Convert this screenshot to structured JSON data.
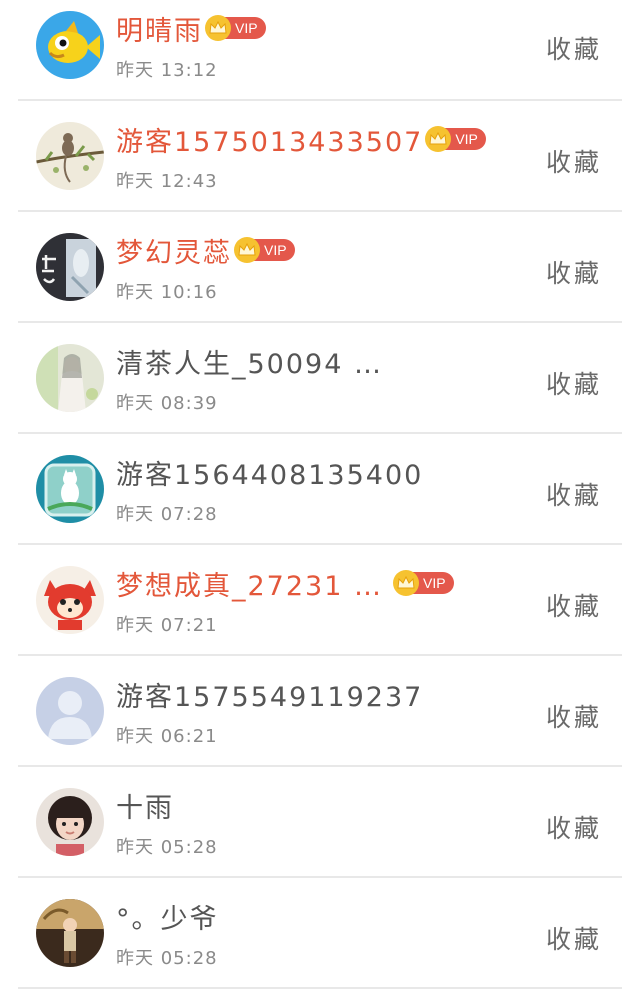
{
  "users": [
    {
      "name": "明晴雨",
      "vip": true,
      "time": "昨天 13:12",
      "action": "收藏",
      "avatar": "fish-avatar-icon"
    },
    {
      "name": "游客1575013433507",
      "vip": true,
      "time": "昨天 12:43",
      "action": "收藏",
      "avatar": "monkey-branch-avatar-icon"
    },
    {
      "name": "梦幻灵蕊",
      "vip": true,
      "time": "昨天 10:16",
      "action": "收藏",
      "avatar": "calligraphy-avatar-icon"
    },
    {
      "name": "清茶人生_50094 …",
      "vip": false,
      "time": "昨天 08:39",
      "action": "收藏",
      "avatar": "painting-avatar-icon"
    },
    {
      "name": "游客1564408135400",
      "vip": false,
      "time": "昨天 07:28",
      "action": "收藏",
      "avatar": "cat-jar-avatar-icon"
    },
    {
      "name": "梦想成真_27231 …",
      "vip": true,
      "time": "昨天 07:21",
      "action": "收藏",
      "avatar": "red-fox-avatar-icon"
    },
    {
      "name": "游客1575549119237",
      "vip": false,
      "time": "昨天 06:21",
      "action": "收藏",
      "avatar": "default-user-avatar-icon"
    },
    {
      "name": "十雨",
      "vip": false,
      "time": "昨天 05:28",
      "action": "收藏",
      "avatar": "girl-photo-avatar-icon"
    },
    {
      "name": "°。少爷",
      "vip": false,
      "time": "昨天 05:28",
      "action": "收藏",
      "avatar": "child-photo-avatar-icon"
    }
  ],
  "vip_label": "VIP",
  "colors": {
    "vip_name": "#e3573a",
    "vip_tag": "#e4584b",
    "crown": "#f6c230",
    "normal_name": "#555555",
    "time": "#8a8a8a",
    "action": "#6a6a6a",
    "divider": "#e8e8e8"
  }
}
